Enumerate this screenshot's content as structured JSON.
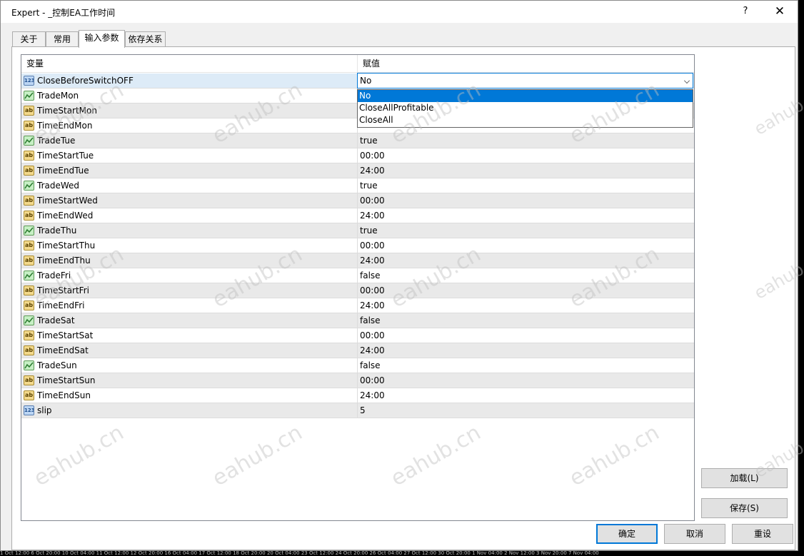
{
  "window": {
    "title": "Expert - _控制EA工作时间",
    "help": "?",
    "close": "✕"
  },
  "tabs": [
    "关于",
    "常用",
    "输入参数",
    "依存关系"
  ],
  "active_tab": 2,
  "grid": {
    "headers": [
      "变量",
      "赋值"
    ],
    "rows": [
      {
        "name": "CloseBeforeSwitchOFF",
        "type": "num",
        "value": "No"
      },
      {
        "name": "TradeMon",
        "type": "bool",
        "value": ""
      },
      {
        "name": "TimeStartMon",
        "type": "str",
        "value": ""
      },
      {
        "name": "TimeEndMon",
        "type": "str",
        "value": ""
      },
      {
        "name": "TradeTue",
        "type": "bool",
        "value": "true"
      },
      {
        "name": "TimeStartTue",
        "type": "str",
        "value": "00:00"
      },
      {
        "name": "TimeEndTue",
        "type": "str",
        "value": "24:00"
      },
      {
        "name": "TradeWed",
        "type": "bool",
        "value": "true"
      },
      {
        "name": "TimeStartWed",
        "type": "str",
        "value": "00:00"
      },
      {
        "name": "TimeEndWed",
        "type": "str",
        "value": "24:00"
      },
      {
        "name": "TradeThu",
        "type": "bool",
        "value": "true"
      },
      {
        "name": "TimeStartThu",
        "type": "str",
        "value": "00:00"
      },
      {
        "name": "TimeEndThu",
        "type": "str",
        "value": "24:00"
      },
      {
        "name": "TradeFri",
        "type": "bool",
        "value": "false"
      },
      {
        "name": "TimeStartFri",
        "type": "str",
        "value": "00:00"
      },
      {
        "name": "TimeEndFri",
        "type": "str",
        "value": "24:00"
      },
      {
        "name": "TradeSat",
        "type": "bool",
        "value": "false"
      },
      {
        "name": "TimeStartSat",
        "type": "str",
        "value": "00:00"
      },
      {
        "name": "TimeEndSat",
        "type": "str",
        "value": "24:00"
      },
      {
        "name": "TradeSun",
        "type": "bool",
        "value": "false"
      },
      {
        "name": "TimeStartSun",
        "type": "str",
        "value": "00:00"
      },
      {
        "name": "TimeEndSun",
        "type": "str",
        "value": "24:00"
      },
      {
        "name": "slip",
        "type": "num",
        "value": "5"
      }
    ]
  },
  "icon_labels": {
    "num": "123",
    "str": "ab"
  },
  "combo": {
    "selected": "No",
    "options": [
      "No",
      "CloseAllProfitable",
      "CloseAll"
    ],
    "highlighted": 0
  },
  "side_buttons": {
    "load": "加载(L)",
    "save": "保存(S)"
  },
  "footer_buttons": {
    "ok": "确定",
    "cancel": "取消",
    "reset": "重设"
  },
  "watermark": "eahub.cn",
  "chart_timeline": "1 Oct 12:00   6 Oct 20:00   10 Oct 04:00   11 Oct 12:00   12 Oct 20:00   16 Oct 04:00   17 Oct 12:00   18 Oct 20:00   20 Oct 04:00   23 Oct 12:00   24 Oct 20:00   26 Oct 04:00   27 Oct 12:00   30 Oct 20:00   1 Nov 04:00   2 Nov 12:00   3 Nov 20:00   7 Nov 04:00",
  "colors": {
    "accent": "#0078d7",
    "selected_row": "#ddebf7",
    "alt_row": "#e9e9e9"
  }
}
